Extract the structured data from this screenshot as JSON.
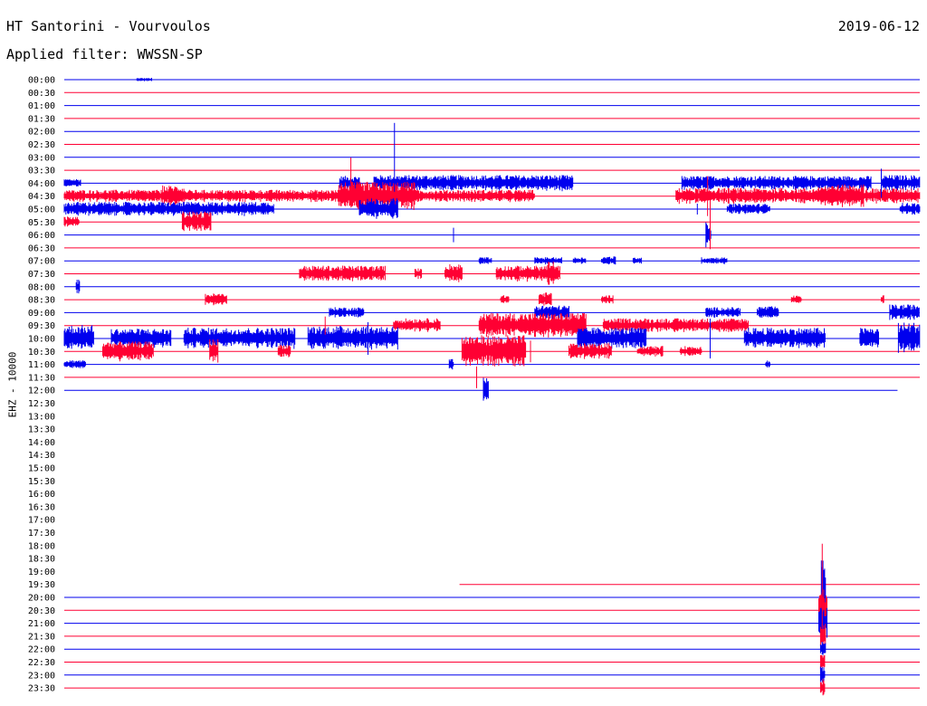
{
  "header": {
    "station": "HT Santorini - Vourvoulos",
    "date": "2019-06-12",
    "filter_label": "Applied filter: WWSSN-SP"
  },
  "axis": {
    "ylabel": "EHZ - 10000"
  },
  "colors": {
    "blue": "#0000ee",
    "red": "#ff0033"
  },
  "chart_data": {
    "type": "helicorder",
    "row_labels": [
      "00:00",
      "00:30",
      "01:00",
      "01:30",
      "02:00",
      "02:30",
      "03:00",
      "03:30",
      "04:00",
      "04:30",
      "05:00",
      "05:30",
      "06:00",
      "06:30",
      "07:00",
      "07:30",
      "08:00",
      "08:30",
      "09:00",
      "09:30",
      "10:00",
      "10:30",
      "11:00",
      "11:30",
      "12:00",
      "12:30",
      "13:00",
      "13:30",
      "14:00",
      "14:30",
      "15:00",
      "15:30",
      "16:00",
      "16:30",
      "17:00",
      "17:30",
      "18:00",
      "18:30",
      "19:00",
      "19:30",
      "20:00",
      "20:30",
      "21:00",
      "21:30",
      "22:00",
      "22:30",
      "23:00",
      "23:30"
    ],
    "row_minutes": 30,
    "x_range_minutes": [
      0,
      30
    ],
    "trace_rows": [
      {
        "row": 0,
        "end": 1.0
      },
      {
        "row": 1,
        "end": 1.0
      },
      {
        "row": 2,
        "end": 1.0
      },
      {
        "row": 3,
        "end": 1.0
      },
      {
        "row": 4,
        "end": 1.0
      },
      {
        "row": 5,
        "end": 1.0
      },
      {
        "row": 6,
        "end": 1.0
      },
      {
        "row": 7,
        "end": 1.0
      },
      {
        "row": 8,
        "end": 1.0
      },
      {
        "row": 9,
        "end": 1.0
      },
      {
        "row": 10,
        "end": 1.0
      },
      {
        "row": 11,
        "end": 1.0
      },
      {
        "row": 12,
        "end": 1.0
      },
      {
        "row": 13,
        "end": 1.0
      },
      {
        "row": 14,
        "end": 1.0
      },
      {
        "row": 15,
        "end": 1.0
      },
      {
        "row": 16,
        "end": 1.0
      },
      {
        "row": 17,
        "end": 1.0
      },
      {
        "row": 18,
        "end": 1.0
      },
      {
        "row": 19,
        "end": 1.0
      },
      {
        "row": 20,
        "end": 1.0
      },
      {
        "row": 21,
        "end": 1.0
      },
      {
        "row": 22,
        "end": 1.0
      },
      {
        "row": 23,
        "end": 1.0
      },
      {
        "row": 24,
        "end": 0.974
      },
      {
        "row": 39,
        "start": 0.462,
        "end": 1.0
      },
      {
        "row": 40,
        "end": 1.0
      },
      {
        "row": 41,
        "end": 1.0
      },
      {
        "row": 42,
        "end": 1.0
      },
      {
        "row": 43,
        "end": 1.0
      },
      {
        "row": 44,
        "end": 1.0
      },
      {
        "row": 45,
        "end": 1.0
      },
      {
        "row": 46,
        "end": 1.0
      },
      {
        "row": 47,
        "end": 1.0
      }
    ],
    "bursts": [
      {
        "row": 0,
        "start": 0.085,
        "end": 0.103,
        "amp": 2
      },
      {
        "row": 8,
        "start": 0.0,
        "end": 0.02,
        "amp": 5
      },
      {
        "row": 8,
        "start": 0.322,
        "end": 0.345,
        "amp": 8
      },
      {
        "row": 8,
        "start": 0.362,
        "end": 0.595,
        "amp": 9
      },
      {
        "row": 8,
        "start": 0.722,
        "end": 0.943,
        "amp": 8
      },
      {
        "row": 8,
        "start": 0.955,
        "end": 1.0,
        "amp": 9
      },
      {
        "row": 9,
        "start": 0.0,
        "end": 0.55,
        "amp": 7
      },
      {
        "row": 9,
        "start": 0.115,
        "end": 0.14,
        "amp": 12
      },
      {
        "row": 9,
        "start": 0.32,
        "end": 0.41,
        "amp": 16
      },
      {
        "row": 9,
        "start": 0.715,
        "end": 1.0,
        "amp": 9
      },
      {
        "row": 9,
        "start": 0.88,
        "end": 0.935,
        "amp": 13
      },
      {
        "row": 10,
        "start": 0.0,
        "end": 0.245,
        "amp": 8
      },
      {
        "row": 10,
        "start": 0.345,
        "end": 0.39,
        "amp": 12
      },
      {
        "row": 10,
        "start": 0.775,
        "end": 0.825,
        "amp": 6
      },
      {
        "row": 10,
        "start": 0.977,
        "end": 1.0,
        "amp": 7
      },
      {
        "row": 11,
        "start": 0.0,
        "end": 0.018,
        "amp": 6
      },
      {
        "row": 11,
        "start": 0.138,
        "end": 0.172,
        "amp": 12
      },
      {
        "row": 12,
        "start": 0.75,
        "end": 0.756,
        "amp": 14
      },
      {
        "row": 14,
        "start": 0.485,
        "end": 0.5,
        "amp": 4
      },
      {
        "row": 14,
        "start": 0.55,
        "end": 0.582,
        "amp": 4
      },
      {
        "row": 14,
        "start": 0.595,
        "end": 0.61,
        "amp": 4
      },
      {
        "row": 14,
        "start": 0.628,
        "end": 0.645,
        "amp": 5
      },
      {
        "row": 14,
        "start": 0.665,
        "end": 0.675,
        "amp": 4
      },
      {
        "row": 14,
        "start": 0.745,
        "end": 0.775,
        "amp": 4
      },
      {
        "row": 15,
        "start": 0.275,
        "end": 0.375,
        "amp": 9
      },
      {
        "row": 15,
        "start": 0.41,
        "end": 0.418,
        "amp": 6
      },
      {
        "row": 15,
        "start": 0.445,
        "end": 0.465,
        "amp": 11
      },
      {
        "row": 15,
        "start": 0.505,
        "end": 0.58,
        "amp": 9
      },
      {
        "row": 15,
        "start": 0.565,
        "end": 0.575,
        "amp": 14
      },
      {
        "row": 16,
        "start": 0.014,
        "end": 0.018,
        "amp": 8
      },
      {
        "row": 17,
        "start": 0.165,
        "end": 0.19,
        "amp": 7
      },
      {
        "row": 17,
        "start": 0.51,
        "end": 0.52,
        "amp": 5
      },
      {
        "row": 17,
        "start": 0.555,
        "end": 0.57,
        "amp": 8
      },
      {
        "row": 17,
        "start": 0.628,
        "end": 0.642,
        "amp": 5
      },
      {
        "row": 17,
        "start": 0.85,
        "end": 0.862,
        "amp": 5
      },
      {
        "row": 17,
        "start": 0.955,
        "end": 0.958,
        "amp": 5
      },
      {
        "row": 18,
        "start": 0.31,
        "end": 0.35,
        "amp": 6
      },
      {
        "row": 18,
        "start": 0.55,
        "end": 0.59,
        "amp": 8
      },
      {
        "row": 18,
        "start": 0.75,
        "end": 0.79,
        "amp": 6
      },
      {
        "row": 18,
        "start": 0.81,
        "end": 0.835,
        "amp": 7
      },
      {
        "row": 18,
        "start": 0.965,
        "end": 1.0,
        "amp": 9
      },
      {
        "row": 19,
        "start": 0.385,
        "end": 0.44,
        "amp": 8
      },
      {
        "row": 19,
        "start": 0.485,
        "end": 0.61,
        "amp": 14
      },
      {
        "row": 19,
        "start": 0.63,
        "end": 0.8,
        "amp": 8
      },
      {
        "row": 20,
        "start": 0.0,
        "end": 0.035,
        "amp": 15
      },
      {
        "row": 20,
        "start": 0.055,
        "end": 0.125,
        "amp": 11
      },
      {
        "row": 20,
        "start": 0.14,
        "end": 0.27,
        "amp": 12
      },
      {
        "row": 20,
        "start": 0.285,
        "end": 0.39,
        "amp": 14
      },
      {
        "row": 20,
        "start": 0.6,
        "end": 0.68,
        "amp": 12
      },
      {
        "row": 20,
        "start": 0.795,
        "end": 0.89,
        "amp": 12
      },
      {
        "row": 20,
        "start": 0.93,
        "end": 0.952,
        "amp": 12
      },
      {
        "row": 20,
        "start": 0.975,
        "end": 1.0,
        "amp": 18
      },
      {
        "row": 21,
        "start": 0.045,
        "end": 0.105,
        "amp": 11
      },
      {
        "row": 21,
        "start": 0.17,
        "end": 0.18,
        "amp": 14
      },
      {
        "row": 21,
        "start": 0.25,
        "end": 0.265,
        "amp": 8
      },
      {
        "row": 21,
        "start": 0.465,
        "end": 0.54,
        "amp": 18
      },
      {
        "row": 21,
        "start": 0.59,
        "end": 0.64,
        "amp": 9
      },
      {
        "row": 21,
        "start": 0.67,
        "end": 0.7,
        "amp": 6
      },
      {
        "row": 21,
        "start": 0.72,
        "end": 0.745,
        "amp": 6
      },
      {
        "row": 22,
        "start": 0.0,
        "end": 0.025,
        "amp": 5
      },
      {
        "row": 22,
        "start": 0.45,
        "end": 0.455,
        "amp": 6
      },
      {
        "row": 22,
        "start": 0.82,
        "end": 0.825,
        "amp": 5
      },
      {
        "row": 24,
        "start": 0.49,
        "end": 0.496,
        "amp": 14
      },
      {
        "row": 40,
        "start": 0.885,
        "end": 0.89,
        "amp": 60
      },
      {
        "row": 41,
        "start": 0.882,
        "end": 0.892,
        "amp": 25
      },
      {
        "row": 42,
        "start": 0.882,
        "end": 0.892,
        "amp": 18
      },
      {
        "row": 43,
        "start": 0.884,
        "end": 0.89,
        "amp": 14
      },
      {
        "row": 44,
        "start": 0.884,
        "end": 0.89,
        "amp": 10
      },
      {
        "row": 45,
        "start": 0.884,
        "end": 0.889,
        "amp": 10
      },
      {
        "row": 46,
        "start": 0.884,
        "end": 0.889,
        "amp": 10
      },
      {
        "row": 47,
        "start": 0.884,
        "end": 0.889,
        "amp": 10
      }
    ],
    "spikes": [
      {
        "row": 6,
        "at": 0.386,
        "amp": 38
      },
      {
        "row": 7,
        "at": 0.335,
        "amp": 14
      },
      {
        "row": 8,
        "at": 0.955,
        "amp": 16
      },
      {
        "row": 9,
        "at": 0.752,
        "amp": 22
      },
      {
        "row": 10,
        "at": 0.74,
        "amp": 6
      },
      {
        "row": 11,
        "at": 0.755,
        "amp": 30
      },
      {
        "row": 12,
        "at": 0.455,
        "amp": 8
      },
      {
        "row": 19,
        "at": 0.305,
        "amp": 10
      },
      {
        "row": 20,
        "at": 0.355,
        "amp": 18
      },
      {
        "row": 20,
        "at": 0.755,
        "amp": 22
      },
      {
        "row": 21,
        "at": 0.545,
        "amp": 12
      },
      {
        "row": 23,
        "at": 0.482,
        "amp": 12
      },
      {
        "row": 39,
        "at": 0.886,
        "amp": 45
      }
    ]
  }
}
